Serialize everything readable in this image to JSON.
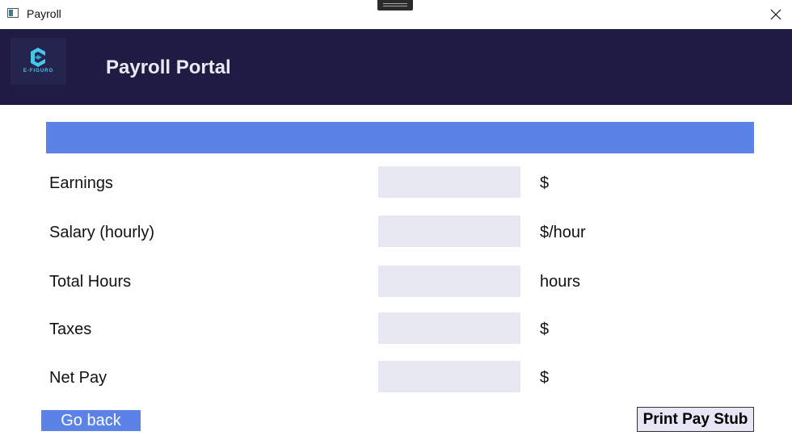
{
  "window": {
    "title": "Payroll",
    "icon": "app-window-icon"
  },
  "header": {
    "title": "Payroll Portal",
    "logo_text": "E-FIGURO",
    "logo_icon": "e-logo-icon",
    "background": "#1e1c42"
  },
  "banner": {
    "color": "#5b82e6"
  },
  "form": {
    "rows": [
      {
        "label": "Earnings",
        "unit": "$",
        "value": ""
      },
      {
        "label": "Salary (hourly)",
        "unit": "$/hour",
        "value": ""
      },
      {
        "label": "Total Hours",
        "unit": "hours",
        "value": ""
      },
      {
        "label": "Taxes",
        "unit": "$",
        "value": ""
      },
      {
        "label": "Net Pay",
        "unit": "$",
        "value": ""
      }
    ]
  },
  "actions": {
    "back_label": "Go back",
    "print_label": "Print Pay Stub"
  },
  "colors": {
    "accent": "#5b82e6",
    "input_bg": "#e8e8f2"
  }
}
